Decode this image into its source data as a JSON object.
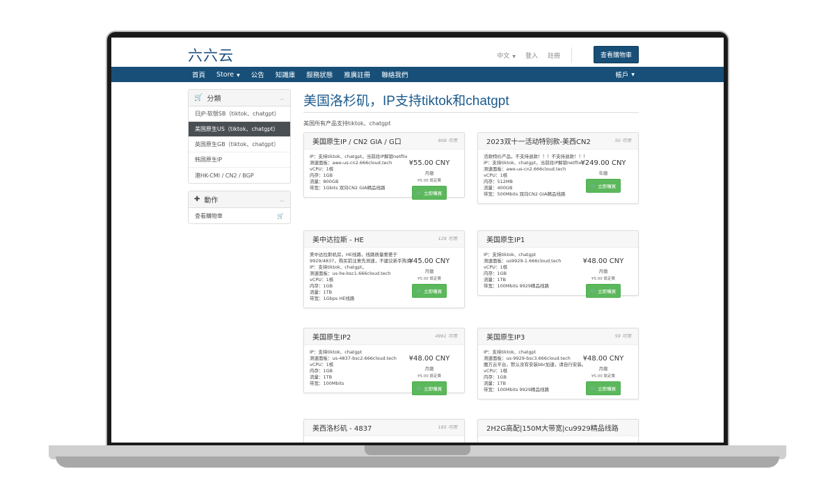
{
  "site": {
    "logo": "六六云"
  },
  "top_links": {
    "language": "中文",
    "login": "登入",
    "register": "註冊",
    "cart": "查看購物車"
  },
  "nav": {
    "items": [
      "首頁",
      "Store",
      "公告",
      "知識庫",
      "服務狀態",
      "推廣註冊",
      "聯絡我們"
    ],
    "account": "帳戶"
  },
  "sidebar": {
    "categories_title": "分類",
    "categories": [
      "日JP-软银SB（tiktok、chatgpt）",
      "美国原生US（tiktok、chatgpt）",
      "英国原生GB（tiktok、chatgpt）",
      "韩国原生IP",
      "港HK-CMI / CN2 / BGP"
    ],
    "active_index": 1,
    "actions_title": "動作",
    "actions": [
      "查看購物車"
    ]
  },
  "page": {
    "title": "美国洛杉矶，IP支持tiktok和chatgpt",
    "subtitle": "美国所有产品支持tiktok、chatgpt"
  },
  "products": [
    {
      "name": "美国原生IP / CN2 GIA / G口",
      "qty": "908 可用",
      "desc": [
        "IP：支持tiktok、chatgpt，当前段IP解锁netflix",
        "测速面板：awe-us-cn2.666cloud.tech",
        "vCPU：1核",
        "内存：1GB",
        "流量：800GB",
        "带宽：1Gbits 双向CN2 GIA精品线路"
      ],
      "price": "¥55.00 CNY",
      "cycle": "月繳",
      "setup": "¥5.00 設定費",
      "button": "立即購買"
    },
    {
      "name": "2023双十一活动特别款-美西CN2",
      "qty": "50 可用",
      "desc": [
        "活款特价产品，不支持退款！！！不支持退款！！！",
        "IP：支持tiktok、chatgpt，当前段IP解锁netflix",
        "测速面板：awe-us-cn2.666cloud.tech",
        "vCPU：1核",
        "内存：512MB",
        "流量：400GB",
        "带宽：500Mbits 双向CN2 GIA精品线路"
      ],
      "price": "¥249.00 CNY",
      "cycle": "年繳",
      "setup": "",
      "button": "立即購買"
    },
    {
      "name": "美中达拉斯 - HE",
      "qty": "129 可用",
      "desc": [
        "美中达拉斯机房，HE线路，线路质量要差于9929/4837，购买前注意先测速，不建议新手购买",
        "IP：支持tiktok、chatgpt，",
        "测速面板：us-he-bsc1.666cloud.tech",
        "vCPU：1核",
        "内存：1GB",
        "流量：1TB",
        "带宽：1Gbps HE线路"
      ],
      "price": "¥45.00 CNY",
      "cycle": "月繳",
      "setup": "¥5.00 設定費",
      "button": "立即購買"
    },
    {
      "name": "美国原生IP1",
      "qty": "",
      "desc": [
        "IP：支持tiktok、chatgpt",
        "测速面板：us9929-1.666cloud.tech",
        "vCPU：1核",
        "内存：1GB",
        "流量：1TB",
        "带宽：100Mbits 9929精品线路"
      ],
      "price": "¥48.00 CNY",
      "cycle": "月繳",
      "setup": "¥5.00 設定費",
      "button": "立即購買"
    },
    {
      "name": "美国原生IP2",
      "qty": "4961 可用",
      "desc": [
        "IP：支持tiktok、chatgpt",
        "测速面板：us-4837-bsc2.666cloud.tech",
        "vCPU：1核",
        "内存：1GB",
        "流量：1TB",
        "带宽：100Mbits"
      ],
      "price": "¥48.00 CNY",
      "cycle": "月繳",
      "setup": "¥5.00 設定費",
      "button": "立即購買"
    },
    {
      "name": "美国原生IP3",
      "qty": "59 可用",
      "desc": [
        "IP：支持tiktok、chatgpt",
        "测速面板：us-9929-bsc3.666cloud.tech",
        "魔方云平台，默认没有安装bbr加速，请自行安装。",
        "vCPU：1核",
        "内存：1GB",
        "流量：1TB",
        "带宽：100Mbits 9929精品线路"
      ],
      "price": "¥48.00 CNY",
      "cycle": "月繳",
      "setup": "¥5.00 設定費",
      "button": "立即購買"
    },
    {
      "name": "美西洛杉矶 - 4837",
      "qty": "185 可用",
      "desc": [],
      "price": "",
      "cycle": "",
      "setup": "",
      "button": ""
    },
    {
      "name": "2H2G高配|150M大带宽|cu9929精品线路",
      "qty": "",
      "desc": [],
      "price": "",
      "cycle": "",
      "setup": "",
      "button": ""
    }
  ],
  "colors": {
    "brand": "#174f78",
    "buy": "#5cb85c",
    "title": "#1b5a8c"
  }
}
